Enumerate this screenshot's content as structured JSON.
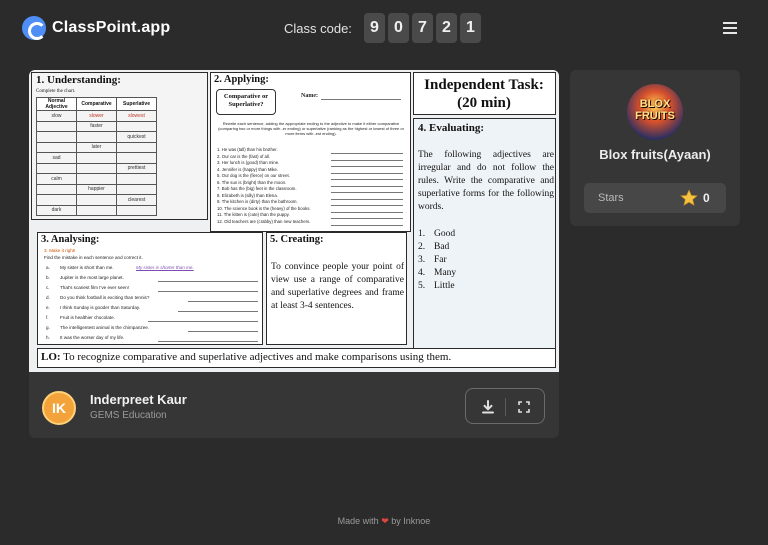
{
  "header": {
    "app_name": "ClassPoint.app",
    "class_code_label": "Class code:",
    "class_code_digits": [
      "9",
      "0",
      "7",
      "2",
      "1"
    ]
  },
  "slide": {
    "understanding": {
      "title": "1.    Understanding:",
      "instruction": "Complete the chart.",
      "columns": [
        "Normal Adjective",
        "Comparative",
        "Superlative"
      ],
      "rows": [
        [
          "slow",
          "slower",
          "slowest"
        ],
        [
          "",
          "faster",
          ""
        ],
        [
          "",
          "",
          "quickest"
        ],
        [
          "",
          "later",
          ""
        ],
        [
          "sad",
          "",
          ""
        ],
        [
          "",
          "",
          "prettiest"
        ],
        [
          "calm",
          "",
          ""
        ],
        [
          "",
          "happier",
          ""
        ],
        [
          "",
          "",
          "clearest"
        ],
        [
          "dark",
          "",
          ""
        ]
      ]
    },
    "applying": {
      "title": "2. Applying:",
      "box_label": "Comparative or Superlative?",
      "name_label": "Name:",
      "instruction": "Rewrite each sentence, adding the appropriate ending to the adjective to make it either comparative (comparing two or more things with -er ending) or superlative (ranking as the highest or lowest of three or more items with -est ending).",
      "sentences": [
        "1. He was (tall) than his brother.",
        "2. Our car is the (fast) of all.",
        "3. Her lunch is (good) than mine.",
        "4. Jennifer is (happy) than Mike.",
        "5. Our dog is the (fierce) on our street.",
        "6. The sun is (bright) than the moon.",
        "7. Bob has the (big) feet in the classroom.",
        "8. Elizabeth is (silly) than Elena.",
        "9. The kitchen is (dirty) than the bathroom.",
        "10. The science book is the (heavy) of the books.",
        "11. The kitten is (cute) than the puppy.",
        "12. Old teachers are (crabby) than new teachers."
      ]
    },
    "independent": {
      "title_line1": "Independent Task:",
      "title_line2": "(20 min)"
    },
    "evaluating": {
      "title": "4. Evaluating:",
      "body": "The following adjectives are irregular and do not follow the rules. Write the comparative and superlative forms for the following words.",
      "words": [
        {
          "num": "1.",
          "word": "Good"
        },
        {
          "num": "2.",
          "word": "Bad"
        },
        {
          "num": "3.",
          "word": "Far"
        },
        {
          "num": "4.",
          "word": "Many"
        },
        {
          "num": "5.",
          "word": "Little"
        }
      ]
    },
    "analysing": {
      "title": "3. Analysing:",
      "subtitle": "3. Make it right!",
      "instruction": "Find the mistake in each sentence and correct it.",
      "items": [
        {
          "letter": "a.",
          "text": "My sister is short than me."
        },
        {
          "letter": "b.",
          "text": "Jupiter is the most large planet."
        },
        {
          "letter": "c.",
          "text": "That's scariest film I've ever seen!"
        },
        {
          "letter": "d.",
          "text": "Do you think football is exciting than tennis?"
        },
        {
          "letter": "e.",
          "text": "I think Sunday is gooder than Saturday."
        },
        {
          "letter": "f.",
          "text": "Fruit is healthier chocolate."
        },
        {
          "letter": "g.",
          "text": "The intelligentest animal is the chimpanzee."
        },
        {
          "letter": "h.",
          "text": "It was the worser day of my life."
        }
      ],
      "example_answer": "My sister is shorter than me."
    },
    "creating": {
      "title": "5. Creating:",
      "body": "To convince people your point of view use a range of comparative and superlative degrees and frame at least 3-4 sentences."
    },
    "objective": {
      "label": "LO:",
      "text": "To recognize comparative and superlative adjectives and make comparisons using them."
    }
  },
  "presenter": {
    "initials": "IK",
    "name": "Inderpreet Kaur",
    "organization": "GEMS Education"
  },
  "student": {
    "avatar_text": "BLOX FRUITS",
    "name": "Blox fruits(Ayaan)",
    "stars_label": "Stars",
    "stars_count": "0"
  },
  "footer": {
    "made_with": "Made with",
    "by": "by Inknoe"
  },
  "colors": {
    "background": "#2b2b2b",
    "card": "#363636",
    "accent_blue": "#4f8ef7",
    "avatar_orange": "#f3a33a",
    "heart_red": "#e0453c"
  }
}
